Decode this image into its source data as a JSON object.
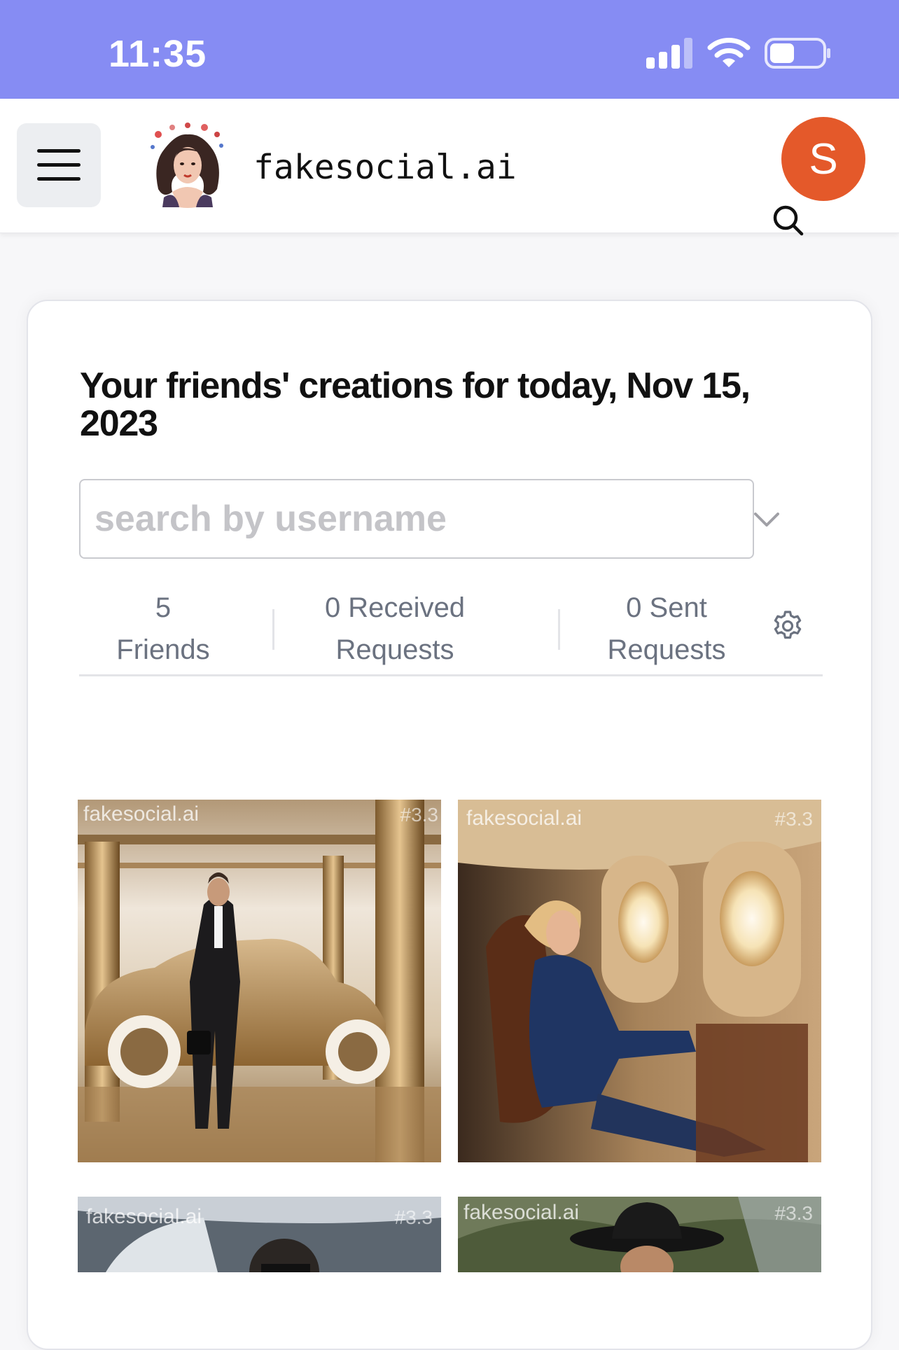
{
  "status_bar": {
    "time": "11:35"
  },
  "header": {
    "brand": "fakesocial.ai",
    "avatar_initial": "S",
    "menu_icon": "hamburger-icon",
    "logo_icon": "woman-portrait-logo"
  },
  "feed": {
    "title": "Your friends' creations for today, Nov 15, 2023",
    "search": {
      "placeholder": "search by username",
      "value": ""
    },
    "stats": {
      "friends_count": "5",
      "friends_label": "Friends",
      "received_count": "0 Received",
      "received_label": "Requests",
      "sent_count": "0 Sent",
      "sent_label": "Requests"
    },
    "tiles": [
      {
        "watermark": "fakesocial.ai",
        "tag": "#3.3",
        "subject": "man in tuxedo beside gold vintage car"
      },
      {
        "watermark": "fakesocial.ai",
        "tag": "#3.3",
        "subject": "woman in blue suit seated in private jet"
      },
      {
        "watermark": "fakesocial.ai",
        "tag": "#3.3",
        "subject": "man with sunglasses near jet"
      },
      {
        "watermark": "fakesocial.ai",
        "tag": "#3.3",
        "subject": "woman in black hat outdoors"
      }
    ]
  },
  "colors": {
    "status_bar": "#868cf3",
    "avatar": "#e4592a",
    "muted_text": "#6b7280"
  }
}
